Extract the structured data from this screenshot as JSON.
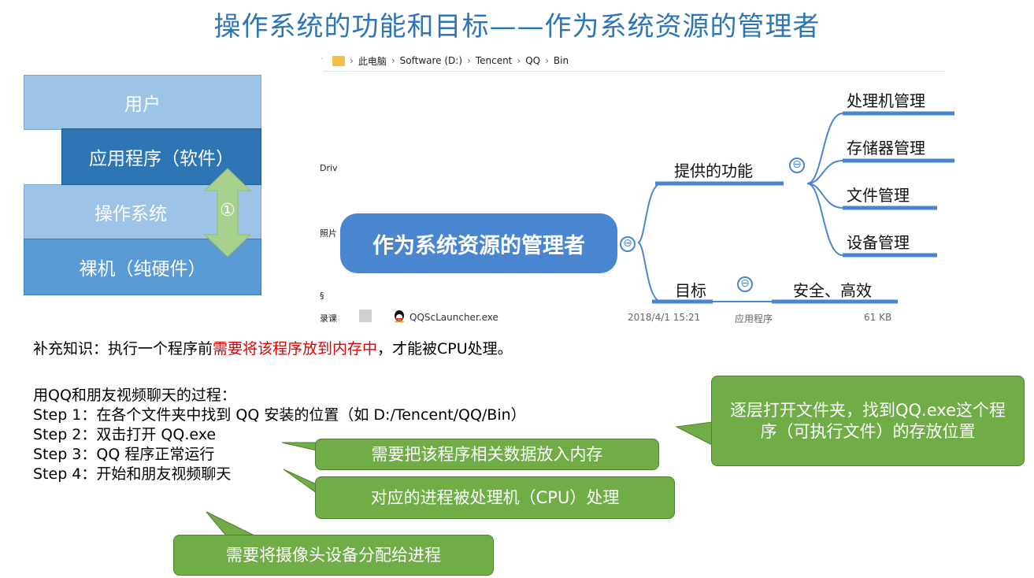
{
  "title": "操作系统的功能和目标——作为系统资源的管理者",
  "layers": {
    "user": "用户",
    "app": "应用程序（软件）",
    "os": "操作系统",
    "hardware": "裸机（纯硬件）",
    "marker": "①"
  },
  "explorer": {
    "breadcrumb": [
      "此电脑",
      "Software (D:)",
      "Tencent",
      "QQ",
      "Bin"
    ],
    "side_fragments": [
      "Driv",
      "照片",
      "§",
      "录课"
    ],
    "file": {
      "name": "QQScLauncher.exe",
      "date": "2018/4/1 15:21",
      "type": "应用程序",
      "size": "61 KB"
    }
  },
  "mindmap": {
    "root": "作为系统资源的管理者",
    "collapse_symbol": "⊖",
    "branch_functions": "提供的功能",
    "functions": [
      "处理机管理",
      "存储器管理",
      "文件管理",
      "设备管理"
    ],
    "branch_goal": "目标",
    "goal_value": "安全、高效"
  },
  "text": {
    "note_prefix": "补充知识：执行一个程序前",
    "note_highlight": "需要将该程序放到内存中",
    "note_suffix": "，才能被CPU处理。",
    "process_title": "用QQ和朋友视频聊天的过程：",
    "steps": [
      "Step 1：在各个文件夹中找到 QQ 安装的位置（如 D:/Tencent/QQ/Bin）",
      "Step 2：双击打开 QQ.exe",
      "Step 3：QQ 程序正常运行",
      "Step 4：开始和朋友视频聊天"
    ]
  },
  "callouts": {
    "folder": "逐层打开文件夹，找到QQ.exe这个程序（可执行文件）的存放位置",
    "memory": "需要把该程序相关数据放入内存",
    "cpu": "对应的进程被处理机（CPU）处理",
    "device": "需要将摄像头设备分配给进程"
  },
  "colors": {
    "title_blue": "#2e75b6",
    "layer_light": "#9dc3e6",
    "layer_dark": "#2e75b6",
    "layer_mid": "#5b9bd5",
    "arrow_green": "#a9d18e",
    "callout_green": "#70ad47",
    "mindmap_blue": "#4a86cf",
    "highlight_red": "#e00000"
  }
}
